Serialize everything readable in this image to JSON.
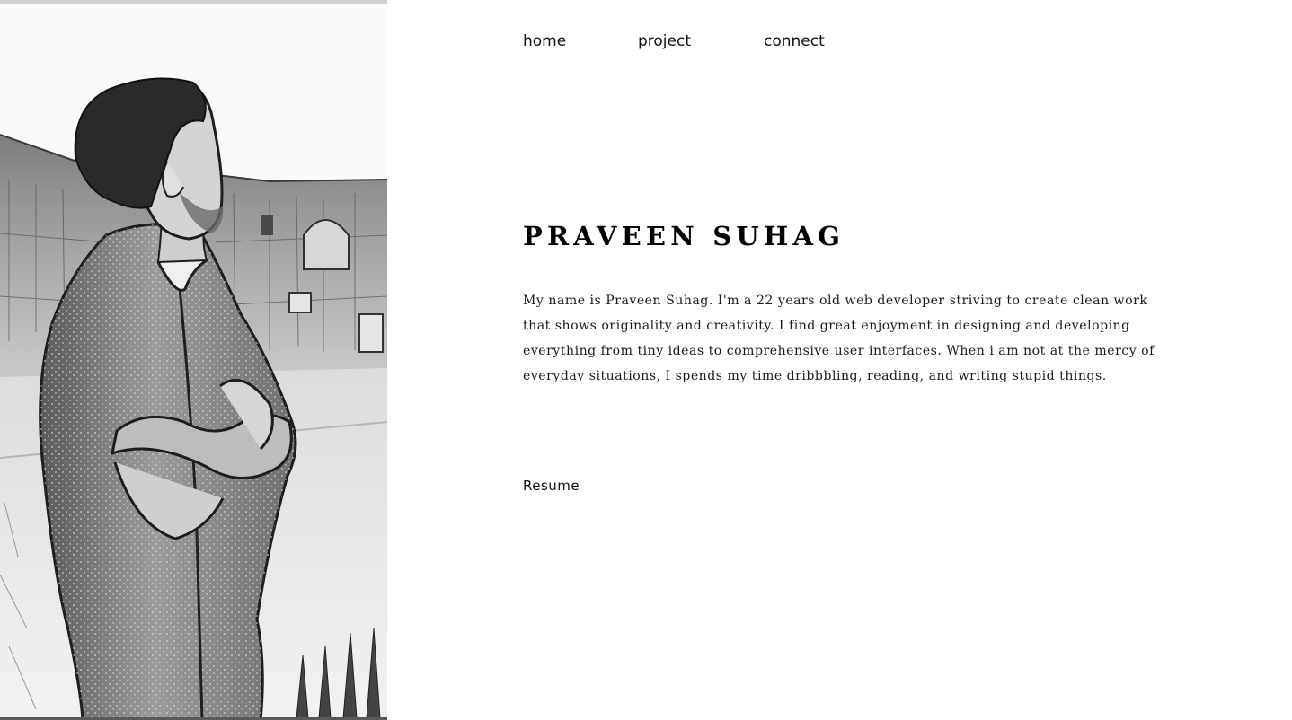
{
  "nav": {
    "home_label": "home",
    "project_label": "project",
    "connect_label": "connect"
  },
  "hero": {
    "name": "PRAVEEN SUHAG",
    "bio": "My name is Praveen Suhag. I'm a 22 years old web developer striving to create clean work that shows originality and creativity. I find great enjoyment in designing and developing everything from tiny ideas to comprehensive user interfaces. When i am not at the mercy of everyday situations, I spends my time dribbbling, reading, and writing stupid things.",
    "resume_label": "Resume"
  },
  "portrait": {
    "style": "black-and-white sketch photo",
    "subject": "man with crossed arms looking to the side in front of a fort wall"
  },
  "colors": {
    "background": "#ffffff",
    "text": "#111111"
  }
}
